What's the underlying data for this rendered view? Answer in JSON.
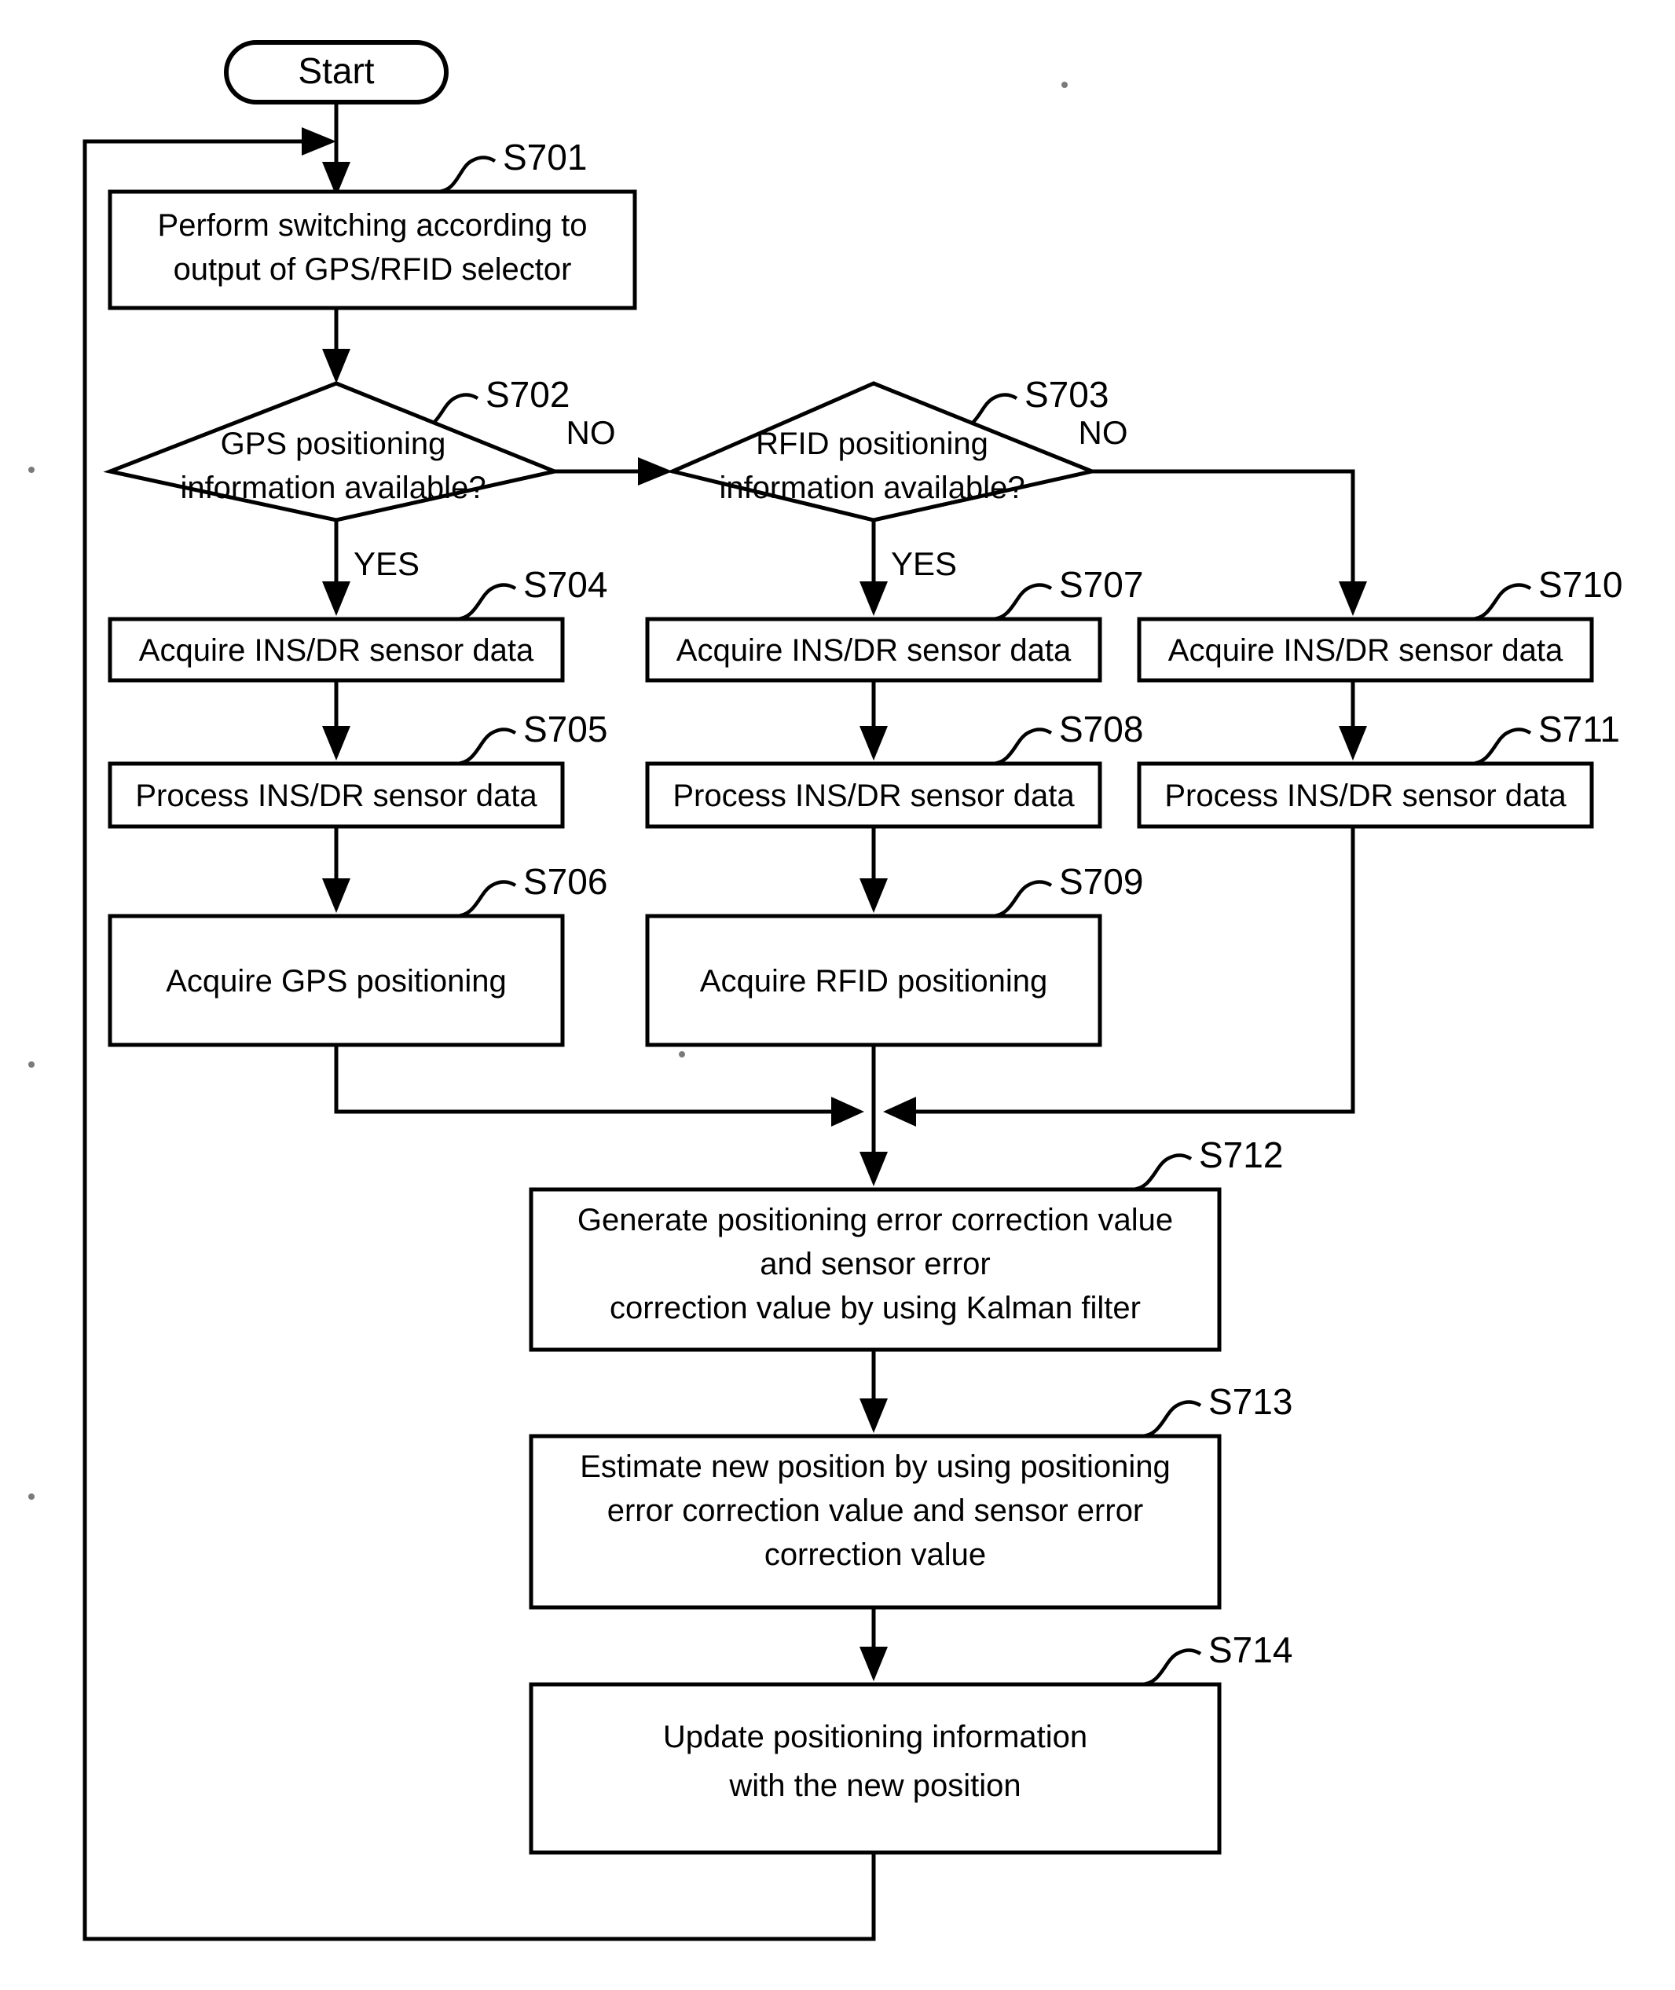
{
  "figure": {
    "type": "flowchart",
    "orientation": "top-to-bottom",
    "background_color": "#ffffff",
    "line_color": "#000000"
  },
  "terminator": {
    "start_label": "Start"
  },
  "nodes": {
    "s701": {
      "step": "S701",
      "line1": "Perform switching according to",
      "line2": "output of GPS/RFID selector"
    },
    "s702": {
      "step": "S702",
      "line1": "GPS positioning",
      "line2": "information available?",
      "yes_label": "YES",
      "no_label": "NO"
    },
    "s703": {
      "step": "S703",
      "line1": "RFID positioning",
      "line2": "information available?",
      "yes_label": "YES",
      "no_label": "NO"
    },
    "s704": {
      "step": "S704",
      "line1": "Acquire INS/DR sensor data"
    },
    "s705": {
      "step": "S705",
      "line1": "Process INS/DR sensor data"
    },
    "s706": {
      "step": "S706",
      "line1": "Acquire GPS positioning"
    },
    "s707": {
      "step": "S707",
      "line1": "Acquire INS/DR sensor data"
    },
    "s708": {
      "step": "S708",
      "line1": "Process INS/DR sensor data"
    },
    "s709": {
      "step": "S709",
      "line1": "Acquire RFID positioning"
    },
    "s710": {
      "step": "S710",
      "line1": "Acquire INS/DR sensor data"
    },
    "s711": {
      "step": "S711",
      "line1": "Process INS/DR sensor data"
    },
    "s712": {
      "step": "S712",
      "line1": "Generate positioning error correction value",
      "line2": "and sensor error",
      "line3": "correction value by using Kalman filter"
    },
    "s713": {
      "step": "S713",
      "line1": "Estimate new position by using positioning",
      "line2": "error correction value and sensor error",
      "line3": "correction value"
    },
    "s714": {
      "step": "S714",
      "line1": "Update positioning information",
      "line2": "with the new position"
    }
  }
}
